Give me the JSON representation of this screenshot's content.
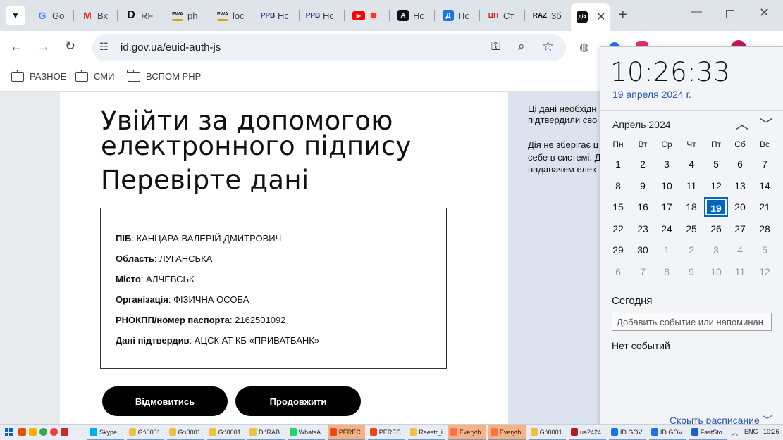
{
  "browser": {
    "tabs": [
      {
        "label": "Go",
        "icon": "google-icon"
      },
      {
        "label": "Вх",
        "icon": "gmail-icon"
      },
      {
        "label": "RF",
        "icon": "d-letter-icon"
      },
      {
        "label": "ph",
        "icon": "pwa-icon"
      },
      {
        "label": "loc",
        "icon": "pwa-icon"
      },
      {
        "label": "Нс",
        "icon": "ppb-icon"
      },
      {
        "label": "Нс",
        "icon": "ppb-icon"
      },
      {
        "label": "",
        "icon": "youtube-icon"
      },
      {
        "label": "Нс",
        "icon": "a-letter-icon"
      },
      {
        "label": "Пс",
        "icon": "d-blue-icon"
      },
      {
        "label": "Ст",
        "icon": "cn-icon"
      },
      {
        "label": "3б",
        "icon": "raz-icon"
      },
      {
        "label": "",
        "icon": "diia-icon",
        "active": true
      }
    ],
    "url": "id.gov.ua/euid-auth-js",
    "bookmarks": [
      "РАЗНОЕ",
      "СМИ",
      "ВСПОМ РНР"
    ]
  },
  "main": {
    "title_line1": "Увійти за допомогою",
    "title_line2": "електронного підпису",
    "subtitle": "Перевірте дані",
    "fields": [
      {
        "label": "ПІБ",
        "value": ": КАНЦАРА ВАЛЕРІЙ ДМИТРОВИЧ"
      },
      {
        "label": "Область",
        "value": ": ЛУГАНСЬКА"
      },
      {
        "label": "Місто",
        "value": ": АЛЧЕВСЬК"
      },
      {
        "label": "Організація",
        "value": ": ФІЗИЧНА ОСОБА"
      },
      {
        "label": "РНОКПП/номер паспорта",
        "value": ": 2162501092"
      },
      {
        "label": "Дані підтвердив",
        "value": ": АЦСК АТ КБ «ПРИВАТБАНК»"
      }
    ],
    "decline_label": "Відмовитись",
    "continue_label": "Продовжити"
  },
  "side": {
    "lines": [
      "Ці дані необхідн",
      "підтвердили сво",
      "Дія не зберігає ц",
      "себе в системі. Д",
      "надавачем елек"
    ]
  },
  "calendar": {
    "time": "10:26:33",
    "date": "19 апреля 2024 г.",
    "month": "Апрель 2024",
    "weekdays": [
      "Пн",
      "Вт",
      "Ср",
      "Чт",
      "Пт",
      "Сб",
      "Вс"
    ],
    "weeks": [
      [
        "1",
        "2",
        "3",
        "4",
        "5",
        "6",
        "7"
      ],
      [
        "8",
        "9",
        "10",
        "11",
        "12",
        "13",
        "14"
      ],
      [
        "15",
        "16",
        "17",
        "18",
        "19",
        "20",
        "21"
      ],
      [
        "22",
        "23",
        "24",
        "25",
        "26",
        "27",
        "28"
      ],
      [
        "29",
        "30",
        "1",
        "2",
        "3",
        "4",
        "5"
      ],
      [
        "6",
        "7",
        "8",
        "9",
        "10",
        "11",
        "12"
      ]
    ],
    "today": "19",
    "today_label": "Сегодня",
    "event_placeholder": "Добавить событие или напоминан",
    "no_events": "Нет событий",
    "hide_schedule": "Скрыть расписание"
  },
  "taskbar": {
    "items": [
      "Skype",
      "G:\\0001...",
      "G:\\0001...",
      "G:\\0001...",
      "D:\\RAB...",
      "WhatsA...",
      "PEREC...",
      "PEREC...",
      "Reestr_i...",
      "Everyth...",
      "Everyth...",
      "G:\\0001...",
      "ua2424...",
      "ID.GOV...",
      "ID.GOV...",
      "FastSto..."
    ],
    "lang": "ENG",
    "clock": "10:26"
  }
}
